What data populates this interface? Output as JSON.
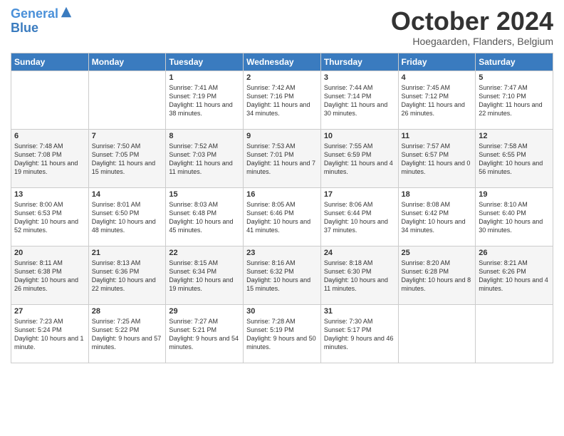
{
  "logo": {
    "line1": "General",
    "line2": "Blue"
  },
  "title": "October 2024",
  "subtitle": "Hoegaarden, Flanders, Belgium",
  "days_of_week": [
    "Sunday",
    "Monday",
    "Tuesday",
    "Wednesday",
    "Thursday",
    "Friday",
    "Saturday"
  ],
  "weeks": [
    [
      {
        "day": "",
        "info": ""
      },
      {
        "day": "",
        "info": ""
      },
      {
        "day": "1",
        "info": "Sunrise: 7:41 AM\nSunset: 7:19 PM\nDaylight: 11 hours and 38 minutes."
      },
      {
        "day": "2",
        "info": "Sunrise: 7:42 AM\nSunset: 7:16 PM\nDaylight: 11 hours and 34 minutes."
      },
      {
        "day": "3",
        "info": "Sunrise: 7:44 AM\nSunset: 7:14 PM\nDaylight: 11 hours and 30 minutes."
      },
      {
        "day": "4",
        "info": "Sunrise: 7:45 AM\nSunset: 7:12 PM\nDaylight: 11 hours and 26 minutes."
      },
      {
        "day": "5",
        "info": "Sunrise: 7:47 AM\nSunset: 7:10 PM\nDaylight: 11 hours and 22 minutes."
      }
    ],
    [
      {
        "day": "6",
        "info": "Sunrise: 7:48 AM\nSunset: 7:08 PM\nDaylight: 11 hours and 19 minutes."
      },
      {
        "day": "7",
        "info": "Sunrise: 7:50 AM\nSunset: 7:05 PM\nDaylight: 11 hours and 15 minutes."
      },
      {
        "day": "8",
        "info": "Sunrise: 7:52 AM\nSunset: 7:03 PM\nDaylight: 11 hours and 11 minutes."
      },
      {
        "day": "9",
        "info": "Sunrise: 7:53 AM\nSunset: 7:01 PM\nDaylight: 11 hours and 7 minutes."
      },
      {
        "day": "10",
        "info": "Sunrise: 7:55 AM\nSunset: 6:59 PM\nDaylight: 11 hours and 4 minutes."
      },
      {
        "day": "11",
        "info": "Sunrise: 7:57 AM\nSunset: 6:57 PM\nDaylight: 11 hours and 0 minutes."
      },
      {
        "day": "12",
        "info": "Sunrise: 7:58 AM\nSunset: 6:55 PM\nDaylight: 10 hours and 56 minutes."
      }
    ],
    [
      {
        "day": "13",
        "info": "Sunrise: 8:00 AM\nSunset: 6:53 PM\nDaylight: 10 hours and 52 minutes."
      },
      {
        "day": "14",
        "info": "Sunrise: 8:01 AM\nSunset: 6:50 PM\nDaylight: 10 hours and 48 minutes."
      },
      {
        "day": "15",
        "info": "Sunrise: 8:03 AM\nSunset: 6:48 PM\nDaylight: 10 hours and 45 minutes."
      },
      {
        "day": "16",
        "info": "Sunrise: 8:05 AM\nSunset: 6:46 PM\nDaylight: 10 hours and 41 minutes."
      },
      {
        "day": "17",
        "info": "Sunrise: 8:06 AM\nSunset: 6:44 PM\nDaylight: 10 hours and 37 minutes."
      },
      {
        "day": "18",
        "info": "Sunrise: 8:08 AM\nSunset: 6:42 PM\nDaylight: 10 hours and 34 minutes."
      },
      {
        "day": "19",
        "info": "Sunrise: 8:10 AM\nSunset: 6:40 PM\nDaylight: 10 hours and 30 minutes."
      }
    ],
    [
      {
        "day": "20",
        "info": "Sunrise: 8:11 AM\nSunset: 6:38 PM\nDaylight: 10 hours and 26 minutes."
      },
      {
        "day": "21",
        "info": "Sunrise: 8:13 AM\nSunset: 6:36 PM\nDaylight: 10 hours and 22 minutes."
      },
      {
        "day": "22",
        "info": "Sunrise: 8:15 AM\nSunset: 6:34 PM\nDaylight: 10 hours and 19 minutes."
      },
      {
        "day": "23",
        "info": "Sunrise: 8:16 AM\nSunset: 6:32 PM\nDaylight: 10 hours and 15 minutes."
      },
      {
        "day": "24",
        "info": "Sunrise: 8:18 AM\nSunset: 6:30 PM\nDaylight: 10 hours and 11 minutes."
      },
      {
        "day": "25",
        "info": "Sunrise: 8:20 AM\nSunset: 6:28 PM\nDaylight: 10 hours and 8 minutes."
      },
      {
        "day": "26",
        "info": "Sunrise: 8:21 AM\nSunset: 6:26 PM\nDaylight: 10 hours and 4 minutes."
      }
    ],
    [
      {
        "day": "27",
        "info": "Sunrise: 7:23 AM\nSunset: 5:24 PM\nDaylight: 10 hours and 1 minute."
      },
      {
        "day": "28",
        "info": "Sunrise: 7:25 AM\nSunset: 5:22 PM\nDaylight: 9 hours and 57 minutes."
      },
      {
        "day": "29",
        "info": "Sunrise: 7:27 AM\nSunset: 5:21 PM\nDaylight: 9 hours and 54 minutes."
      },
      {
        "day": "30",
        "info": "Sunrise: 7:28 AM\nSunset: 5:19 PM\nDaylight: 9 hours and 50 minutes."
      },
      {
        "day": "31",
        "info": "Sunrise: 7:30 AM\nSunset: 5:17 PM\nDaylight: 9 hours and 46 minutes."
      },
      {
        "day": "",
        "info": ""
      },
      {
        "day": "",
        "info": ""
      }
    ]
  ]
}
